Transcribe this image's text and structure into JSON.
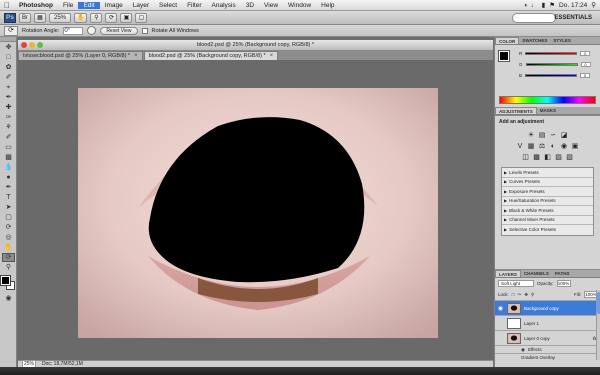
{
  "menubar": {
    "app": "Photoshop",
    "items": [
      "File",
      "Edit",
      "Image",
      "Layer",
      "Select",
      "Filter",
      "Analysis",
      "3D",
      "View",
      "Window",
      "Help"
    ],
    "active_item": "Edit",
    "clock": "Do. 17:24"
  },
  "appbar": {
    "logo": "Ps",
    "zoom": "25%",
    "workspace": "ESSENTIALS"
  },
  "options": {
    "rotation_label": "Rotation Angle:",
    "rotation_value": "0°",
    "reset_label": "Reset View",
    "rotate_all_label": "Rotate All Windows"
  },
  "document": {
    "window_title": "blood2.psd @ 25% (Background copy, RGB/8) *",
    "tabs": [
      {
        "label": "tvissecblood.psd @ 25% (Layer 0, RGB/8) *"
      },
      {
        "label": "blood2.psd @ 25% (Background copy, RGB/8) *"
      }
    ],
    "status_zoom": "25%",
    "status_doc": "Doc: 18,7M/52,1M"
  },
  "panels": {
    "color_tabs": [
      "COLOR",
      "SWATCHES",
      "STYLES"
    ],
    "color_sliders": [
      {
        "label": "R",
        "value": "0"
      },
      {
        "label": "G",
        "value": "0"
      },
      {
        "label": "B",
        "value": "0"
      }
    ],
    "adj_tabs": [
      "ADJUSTMENTS",
      "MASKS"
    ],
    "adj_title": "Add an adjustment",
    "presets": [
      "Levels Presets",
      "Curves Presets",
      "Exposure Presets",
      "Hue/Saturation Presets",
      "Black & White Presets",
      "Channel Mixer Presets",
      "Selective Color Presets"
    ],
    "layer_tabs": [
      "LAYERS",
      "CHANNELS",
      "PATHS"
    ],
    "blend_mode": "Soft Light",
    "opacity_label": "Opacity:",
    "opacity_value": "100%",
    "lock_label": "Lock:",
    "fill_label": "Fill:",
    "fill_value": "100%",
    "layers": [
      {
        "name": "Background copy"
      },
      {
        "name": "Layer 1"
      },
      {
        "name": "Layer 0 copy",
        "fx": "fx"
      }
    ],
    "effects_label": "Effects",
    "gradient_overlay_label": "Gradient Overlay"
  }
}
